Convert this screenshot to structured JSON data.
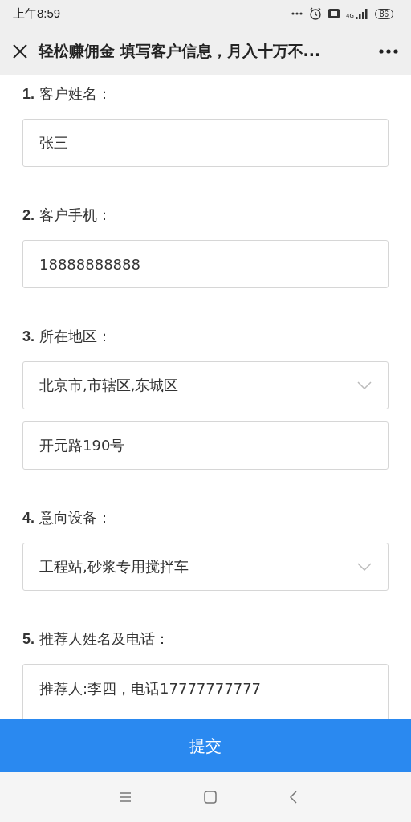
{
  "status_bar": {
    "time": "上午8:59",
    "network": "4G",
    "battery": "86"
  },
  "title_bar": {
    "title": "轻松赚佣金 填写客户信息，月入十万不..."
  },
  "form": {
    "sections": [
      {
        "number": "1.",
        "label": "客户姓名：",
        "fields": [
          {
            "kind": "input",
            "value": "张三"
          }
        ]
      },
      {
        "number": "2.",
        "label": "客户手机：",
        "fields": [
          {
            "kind": "input",
            "value": "18888888888"
          }
        ]
      },
      {
        "number": "3.",
        "label": "所在地区：",
        "fields": [
          {
            "kind": "select",
            "value": "北京市,市辖区,东城区"
          },
          {
            "kind": "input",
            "value": "开元路190号"
          }
        ]
      },
      {
        "number": "4.",
        "label": "意向设备：",
        "fields": [
          {
            "kind": "select",
            "value": "工程站,砂浆专用搅拌车"
          }
        ]
      },
      {
        "number": "5.",
        "label": "推荐人姓名及电话：",
        "fields": [
          {
            "kind": "textarea",
            "value": "推荐人:李四，电话17777777777"
          }
        ]
      }
    ]
  },
  "submit_button": "提交"
}
